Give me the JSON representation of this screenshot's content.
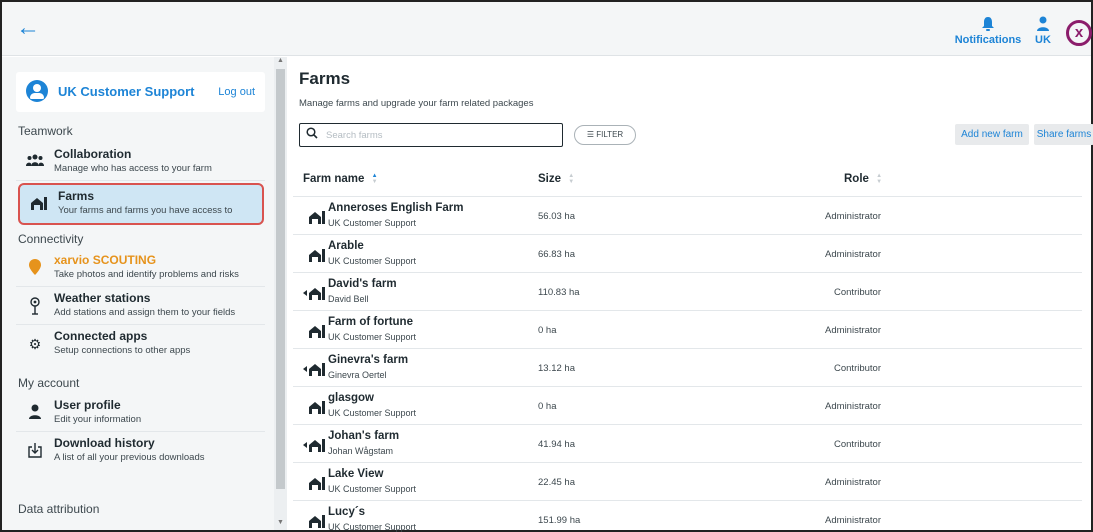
{
  "topbar": {
    "back_icon": "arrow-left-icon",
    "notifications_label": "Notifications",
    "user_label": "UK",
    "logo_glyph": "x",
    "accent": "#1d84d6",
    "logo_color": "#8b1d6b"
  },
  "sidebar": {
    "user_name": "UK Customer Support",
    "logout_label": "Log out",
    "sections": {
      "teamwork": "Teamwork",
      "connectivity": "Connectivity",
      "my_account": "My account",
      "data_attribution": "Data attribution"
    },
    "items": [
      {
        "title": "Collaboration",
        "subtitle": "Manage who has access to your farm",
        "icon": "people-icon"
      },
      {
        "title": "Farms",
        "subtitle": "Your farms and farms you have access to",
        "icon": "farm-icon",
        "active": true
      },
      {
        "title": "xarvio SCOUTING",
        "subtitle": "Take photos and identify problems and risks",
        "icon": "location-pin-icon"
      },
      {
        "title": "Weather stations",
        "subtitle": "Add stations and assign them to your fields",
        "icon": "weather-station-icon"
      },
      {
        "title": "Connected apps",
        "subtitle": "Setup connections to other apps",
        "icon": "gear-icon"
      },
      {
        "title": "User profile",
        "subtitle": "Edit your information",
        "icon": "user-icon"
      },
      {
        "title": "Download history",
        "subtitle": "A list of all your previous downloads",
        "icon": "download-icon"
      }
    ],
    "active_border_color": "#d9534f",
    "scouting_color": "#e6931c"
  },
  "main": {
    "title": "Farms",
    "subtitle": "Manage farms and upgrade your farm related packages",
    "search_placeholder": "Search farms",
    "filter_label": "FILTER",
    "add_label": "Add new farm",
    "share_label": "Share farms",
    "columns": {
      "name": "Farm name",
      "size": "Size",
      "role": "Role"
    },
    "farms": [
      {
        "name": "Anneroses English Farm",
        "owner": "UK Customer Support",
        "size": "56.03 ha",
        "role": "Administrator",
        "shared": false
      },
      {
        "name": "Arable",
        "owner": "UK Customer Support",
        "size": "66.83 ha",
        "role": "Administrator",
        "shared": false
      },
      {
        "name": "David's farm",
        "owner": "David Bell",
        "size": "110.83 ha",
        "role": "Contributor",
        "shared": true
      },
      {
        "name": "Farm of fortune",
        "owner": "UK Customer Support",
        "size": "0 ha",
        "role": "Administrator",
        "shared": false
      },
      {
        "name": "Ginevra's farm",
        "owner": "Ginevra Oertel",
        "size": "13.12 ha",
        "role": "Contributor",
        "shared": true
      },
      {
        "name": "glasgow",
        "owner": "UK Customer Support",
        "size": "0 ha",
        "role": "Administrator",
        "shared": false
      },
      {
        "name": "Johan's farm",
        "owner": "Johan Wågstam",
        "size": "41.94 ha",
        "role": "Contributor",
        "shared": true
      },
      {
        "name": "Lake View",
        "owner": "UK Customer Support",
        "size": "22.45 ha",
        "role": "Administrator",
        "shared": false
      },
      {
        "name": "Lucy´s",
        "owner": "UK Customer Support",
        "size": "151.99 ha",
        "role": "Administrator",
        "shared": false
      }
    ]
  }
}
